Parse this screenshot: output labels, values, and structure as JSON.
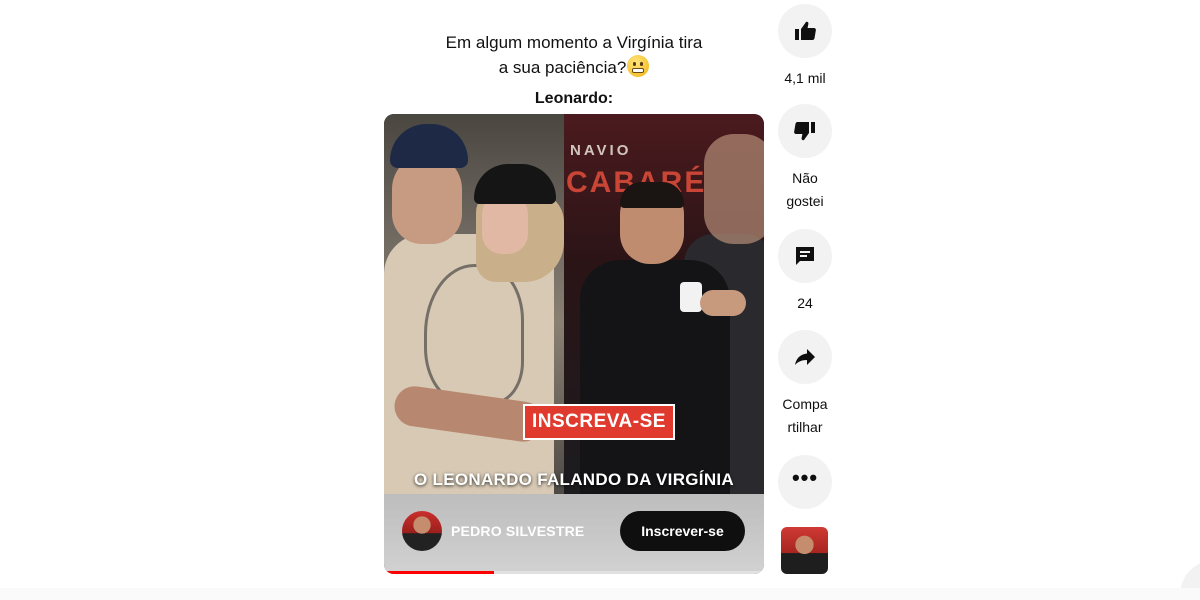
{
  "caption": {
    "line1": "Em algum momento a Virgínia tira",
    "line2": "a sua paciência?",
    "emoji": "grimacing-face",
    "speaker": "Leonardo:"
  },
  "video": {
    "overlay_subscribe": "INSCREVA-SE",
    "overlay_caption": "O LEONARDO FALANDO DA VIRGÍNIA",
    "progress_percent": 29,
    "scene_text_sign": "NAVIO",
    "scene_text_sign2": "CABARÉ"
  },
  "channel": {
    "name": "PEDRO SILVESTRE",
    "subscribe_label": "Inscrever-se"
  },
  "actions": {
    "like": {
      "icon": "thumbs-up-icon",
      "label": "4,1 mil"
    },
    "dislike": {
      "icon": "thumbs-down-icon",
      "label_line1": "Não",
      "label_line2": "gostei"
    },
    "comments": {
      "icon": "comment-icon",
      "label": "24"
    },
    "share": {
      "icon": "share-arrow-icon",
      "label_line1": "Compa",
      "label_line2": "rtilhar"
    },
    "more": {
      "icon": "more-horizontal-icon",
      "glyph": "•••"
    }
  },
  "colors": {
    "subscribe_overlay": "#e03a2f",
    "progress": "#ff0000",
    "action_bg": "#f2f2f2",
    "button_dark": "#0f0f0f"
  }
}
